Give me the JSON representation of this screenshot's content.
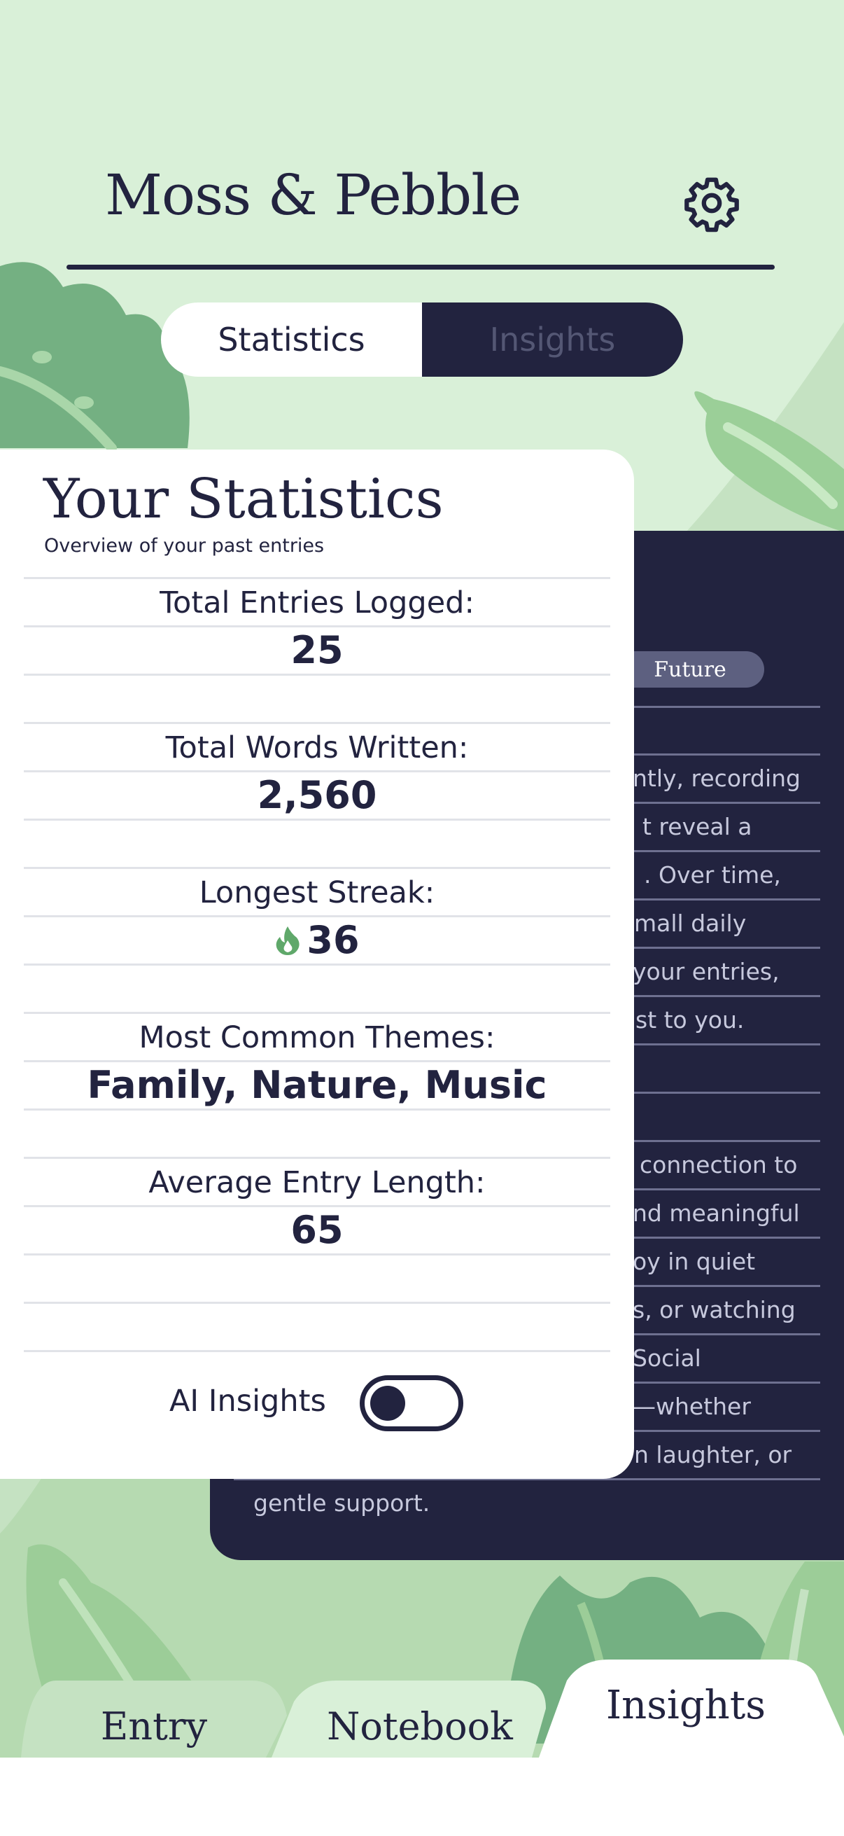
{
  "app": {
    "title": "Moss & Pebble"
  },
  "tabs": {
    "statistics": "Statistics",
    "insights": "Insights"
  },
  "stats": {
    "title": "Your Statistics",
    "subtitle": "Overview of your past entries",
    "items": [
      {
        "label": "Total Entries Logged:",
        "value": "25"
      },
      {
        "label": "Total Words Written:",
        "value": "2,560"
      },
      {
        "label": "Longest Streak:",
        "value": "36",
        "icon": "flame-icon"
      },
      {
        "label": "Most Common Themes:",
        "value": "Family, Nature, Music"
      },
      {
        "label": "Average Entry Length:",
        "value": "65"
      }
    ],
    "ai_insights_label": "AI Insights",
    "ai_insights_enabled": false
  },
  "back_card": {
    "pill": "Future",
    "lines": [
      "ntly, recording",
      "t reveal a",
      ". Over time,",
      "mall daily",
      "your entries,",
      "st to you.",
      "connection to",
      "nd meaningful",
      "oy in quiet",
      "s, or watching",
      "Social",
      "—whether",
      "n laughter, or",
      "gentle support."
    ]
  },
  "bottom_nav": {
    "entry": "Entry",
    "notebook": "Notebook",
    "insights": "Insights"
  },
  "colors": {
    "navy": "#22233f",
    "mint": "#d9f0d8",
    "leaf": "#6aa877",
    "white": "#ffffff"
  }
}
